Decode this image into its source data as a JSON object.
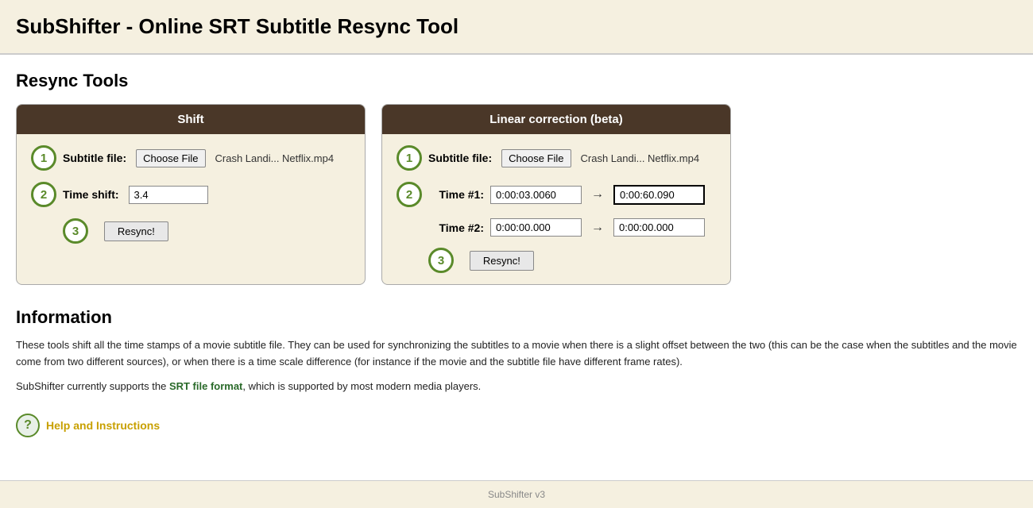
{
  "header": {
    "title": "SubShifter - Online SRT Subtitle Resync Tool"
  },
  "resync_tools_label": "Resync Tools",
  "shift_panel": {
    "title": "Shift",
    "step1_label": "Subtitle file:",
    "choose_file_label": "Choose File",
    "file_name": "Crash Landi... Netflix.mp4",
    "step2_label": "Time shift:",
    "time_shift_value": "3.4",
    "resync_label": "Resync!"
  },
  "linear_panel": {
    "title": "Linear correction (beta)",
    "step1_label": "Subtitle file:",
    "choose_file_label": "Choose File",
    "file_name": "Crash Landi... Netflix.mp4",
    "step2_label": "Time #1:",
    "time1_from": "0:00:03.0060",
    "time1_to": "0:00:60.090",
    "step3_label": "Time #2:",
    "time2_from": "0:00:00.000",
    "time2_to": "0:00:00.000",
    "resync_label": "Resync!",
    "arrow": "→"
  },
  "information": {
    "title": "Information",
    "para1": "These tools shift all the time stamps of a movie subtitle file. They can be used for synchronizing the subtitles to a movie when there is a slight offset between the two (this can be the case when the subtitles and the movie come from two different sources), or when there is a time scale difference (for instance if the movie and the subtitle file have different frame rates).",
    "para2_prefix": "SubShifter currently supports the ",
    "para2_link": "SRT file format",
    "para2_suffix": ", which is supported by most modern media players.",
    "help_label": "Help and Instructions"
  },
  "footer": {
    "text": "SubShifter v3"
  }
}
